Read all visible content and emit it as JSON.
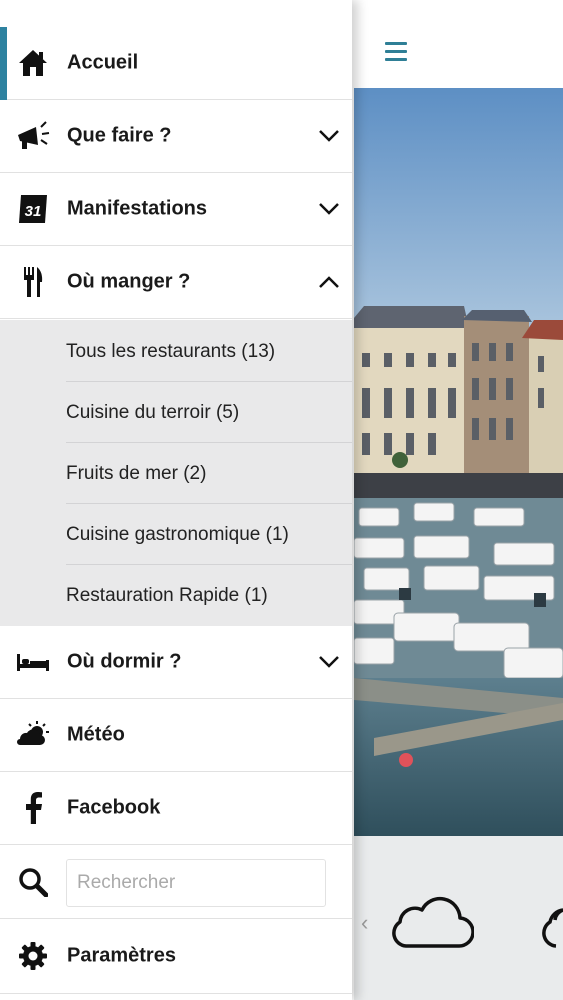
{
  "background": {
    "accent_color": "#2e82a0"
  },
  "menu": {
    "items": [
      {
        "label": "Accueil",
        "icon": "home-icon"
      },
      {
        "label": "Que faire ?",
        "icon": "megaphone-icon"
      },
      {
        "label": "Manifestations",
        "icon": "calendar-icon",
        "calendar_day": "31"
      },
      {
        "label": "Où manger ?",
        "icon": "fork-knife-icon"
      },
      {
        "label": "Où dormir ?",
        "icon": "bed-icon"
      },
      {
        "label": "Météo",
        "icon": "weather-icon"
      },
      {
        "label": "Facebook",
        "icon": "facebook-icon"
      },
      {
        "label": "Paramètres",
        "icon": "gear-icon"
      }
    ],
    "restaurants": [
      "Tous les restaurants (13)",
      "Cuisine du terroir (5)",
      "Fruits de mer (2)",
      "Cuisine gastronomique (1)",
      "Restauration Rapide (1)"
    ],
    "search": {
      "placeholder": "Rechercher",
      "value": ""
    }
  }
}
